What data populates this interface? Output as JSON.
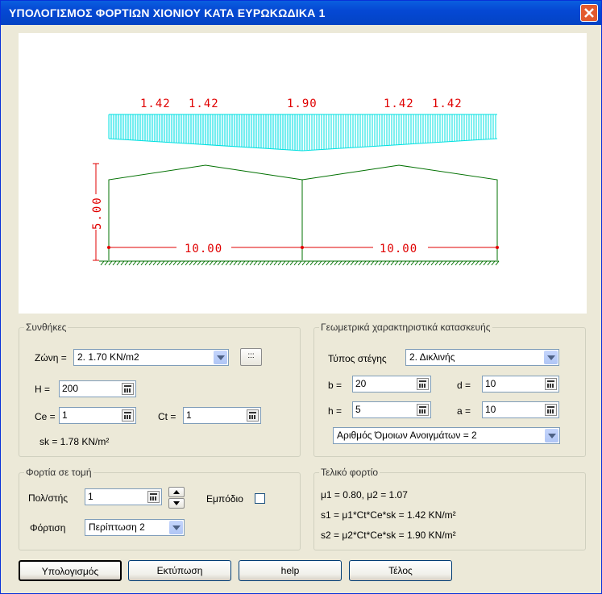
{
  "window": {
    "title": "ΥΠΟΛΟΓΙΣΜΟΣ ΦΟΡΤΙΩΝ ΧΙΟΝΙΟΥ ΚΑΤΑ ΕΥΡΩΚΩΔΙΚΑ 1"
  },
  "drawing": {
    "load_values": [
      "1.42",
      "1.42",
      "1.90",
      "1.42",
      "1.42"
    ],
    "height_dim": "5.00",
    "span_dims": [
      "10.00",
      "10.00"
    ],
    "colors": {
      "load": "#00ffff",
      "text": "#e00000",
      "frame": "#007000"
    }
  },
  "conditions": {
    "legend": "Συνθήκες",
    "zone_label": "Ζώνη =",
    "zone_value": "2. 1.70 KN/m2",
    "zone_button": ":::",
    "H_label": "H =",
    "H_value": "200",
    "Ce_label": "Ce =",
    "Ce_value": "1",
    "Ct_label": "Ct =",
    "Ct_value": "1",
    "sk_text": "sk = 1.78 KN/m²"
  },
  "geometry": {
    "legend": "Γεωμετρικά χαρακτηριστικά κατασκευής",
    "roof_type_label": "Τύπος στέγης",
    "roof_type_value": "2. Δικλινής",
    "b_label": "b =",
    "b_value": "20",
    "d_label": "d =",
    "d_value": "10",
    "h_label": "h =",
    "h_value": "5",
    "a_label": "a =",
    "a_value": "10",
    "openings_value": "Αριθμός Όμοιων Ανοιγμάτων = 2"
  },
  "section_loads": {
    "legend": "Φορτία σε τομή",
    "multiroof_label": "Πολ/στής",
    "multiroof_value": "1",
    "obstacle_label": "Εμπόδιο",
    "load_case_label": "Φόρτιση",
    "load_case_value": "Περίπτωση 2"
  },
  "final_load": {
    "legend": "Τελικό φορτίο",
    "mu_text": "μ1 = 0.80,  μ2 = 1.07",
    "s1_text": "s1 = μ1*Ct*Ce*sk = 1.42 KN/m²",
    "s2_text": "s2 = μ2*Ct*Ce*sk = 1.90 KN/m²"
  },
  "buttons": {
    "calculate": "Υπολογισμός",
    "print": "Εκτύπωση",
    "help": "help",
    "end": "Τέλος"
  }
}
